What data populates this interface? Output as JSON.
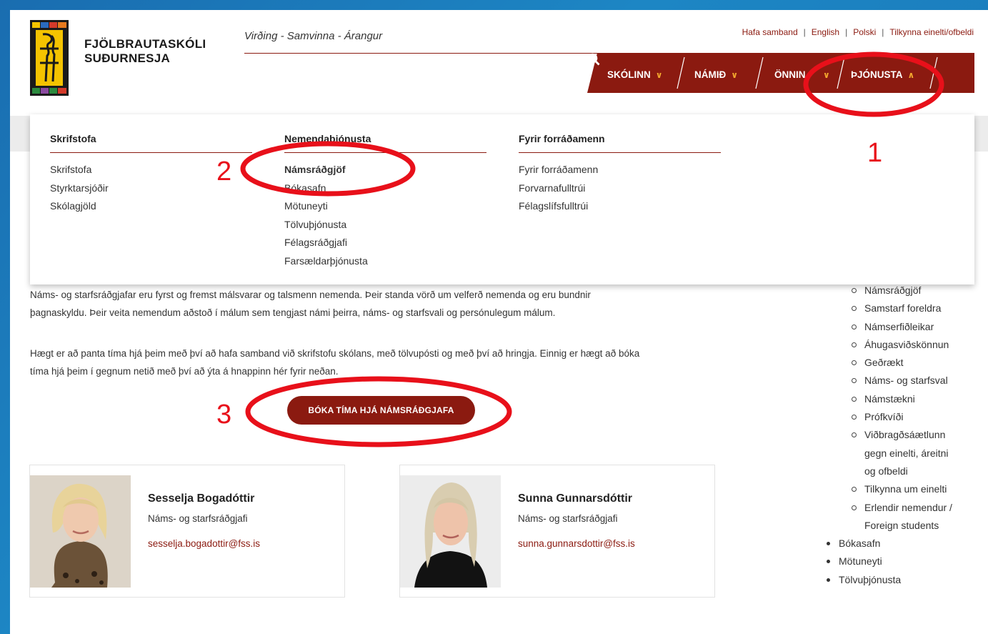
{
  "header": {
    "school_line1": "FJÖLBRAUTASKÓLI",
    "school_line2": "SUÐURNESJA",
    "motto": "Virðing - Samvinna - Árangur",
    "top_links": [
      "Hafa samband",
      "English",
      "Polski",
      "Tilkynna einelti/ofbeldi"
    ]
  },
  "nav": {
    "items": [
      "SKÓLINN",
      "NÁMIÐ",
      "ÖNNIN",
      "ÞJÓNUSTA"
    ],
    "search_icon": "search-icon",
    "chevron_color": "#f2a72e",
    "bar_color": "#8b1a10"
  },
  "mega_menu": {
    "col1": {
      "heading": "Skrifstofa",
      "items": [
        "Skrifstofa",
        "Styrktarsjóðir",
        "Skólagjöld"
      ]
    },
    "col2": {
      "heading": "Nemendaþjónusta",
      "items": [
        "Námsráðgjöf",
        "Bókasafn",
        "Mötuneyti",
        "Tölvuþjónusta",
        "Félagsráðgjafi",
        "Farsældarþjónusta"
      ]
    },
    "col3": {
      "heading": "Fyrir forráðamenn",
      "items": [
        "Fyrir forráðamenn",
        "Forvarnafulltrúi",
        "Félagslífsfulltrúi"
      ]
    }
  },
  "content": {
    "para1_line1": "Náms- og starfsráðgjafar eru fyrst og fremst málsvarar og talsmenn nemenda. Þeir standa vörð um velferð nemenda og eru bundnir",
    "para1_line2": "þagnaskyldu. Þeir veita nemendum aðstoð í málum sem tengjast námi þeirra, náms- og starfsvali og persónulegum málum.",
    "para2_line1": "Hægt er að panta tíma hjá þeim með því að hafa samband við skrifstofu skólans, með tölvupósti og með því að hringja. Einnig er hægt að bóka",
    "para2_line2": "tíma hjá þeim í gegnum netið með því að ýta á hnappinn hér fyrir neðan.",
    "book_button": "BÓKA TÍMA HJÁ NÁMSRÁÐGJAFA"
  },
  "staff": [
    {
      "name": "Sesselja Bogadóttir",
      "role": "Náms- og starfsráðgjafi",
      "email": "sesselja.bogadottir@fss.is"
    },
    {
      "name": "Sunna Gunnarsdóttir",
      "role": "Náms- og starfsráðgjafi",
      "email": "sunna.gunnarsdottir@fss.is"
    }
  ],
  "sidebar": {
    "sub_items": [
      "Námsráðgjöf",
      "Samstarf foreldra",
      "Námserfiðleikar",
      "Áhugasviðskönnun",
      "Geðrækt",
      "Náms- og starfsval",
      "Námstækni",
      "Prófkvíði",
      "Viðbragðsáætlunn",
      "gegn einelti, áreitni",
      "og ofbeldi",
      "Tilkynna um einelti",
      "Erlendir nemendur /",
      "Foreign students"
    ],
    "top_items": [
      "Bókasafn",
      "Mötuneyti",
      "Tölvuþjónusta"
    ]
  },
  "annotations": {
    "n1": "1",
    "n2": "2",
    "n3": "3",
    "color": "#e8101a"
  }
}
